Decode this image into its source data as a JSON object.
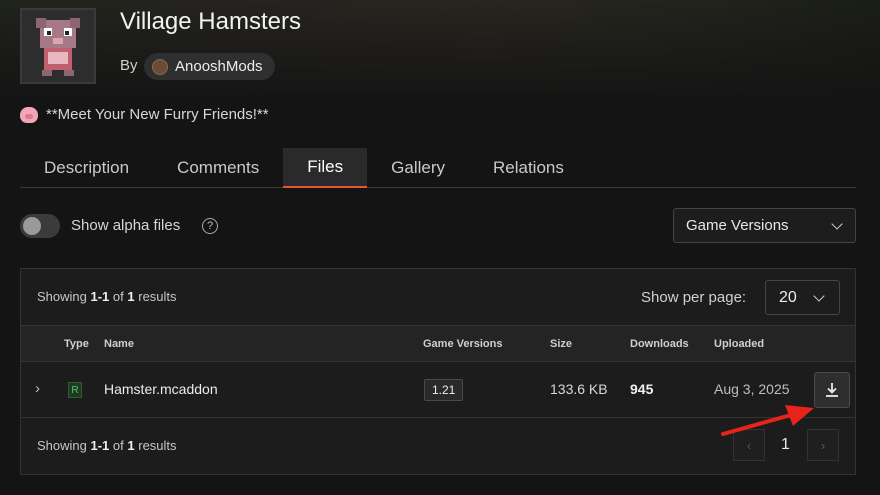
{
  "project": {
    "title": "Village Hamsters",
    "by_label": "By",
    "author": "AnooshMods",
    "summary": "**Meet Your New Furry Friends!**"
  },
  "tabs": [
    {
      "label": "Description",
      "active": false
    },
    {
      "label": "Comments",
      "active": false
    },
    {
      "label": "Files",
      "active": true
    },
    {
      "label": "Gallery",
      "active": false
    },
    {
      "label": "Relations",
      "active": false
    }
  ],
  "filters": {
    "alpha_toggle_label": "Show alpha files",
    "alpha_enabled": false,
    "help_glyph": "?",
    "game_versions_label": "Game Versions"
  },
  "results": {
    "prefix": "Showing",
    "range": "1-1",
    "of_label": "of",
    "total": "1",
    "suffix": "results",
    "per_page_label": "Show per page:",
    "per_page_value": "20"
  },
  "table": {
    "headers": [
      "Type",
      "Name",
      "Game Versions",
      "Size",
      "Downloads",
      "Uploaded"
    ],
    "rows": [
      {
        "type": "R",
        "name": "Hamster.mcaddon",
        "game_version": "1.21",
        "size": "133.6 KB",
        "downloads": "945",
        "uploaded": "Aug 3, 2025"
      }
    ]
  },
  "pagination": {
    "prev": "‹",
    "current": "1",
    "next": "›"
  },
  "colors": {
    "accent": "#e0582c",
    "release_badge": "#58c266",
    "annotation_arrow": "#e8231c"
  },
  "icons": {
    "expand": "chevron-right-icon",
    "download": "download-icon",
    "dropdown": "chevron-down-icon",
    "help": "help-circle-icon",
    "summary_emoji": "pig-face-icon"
  }
}
